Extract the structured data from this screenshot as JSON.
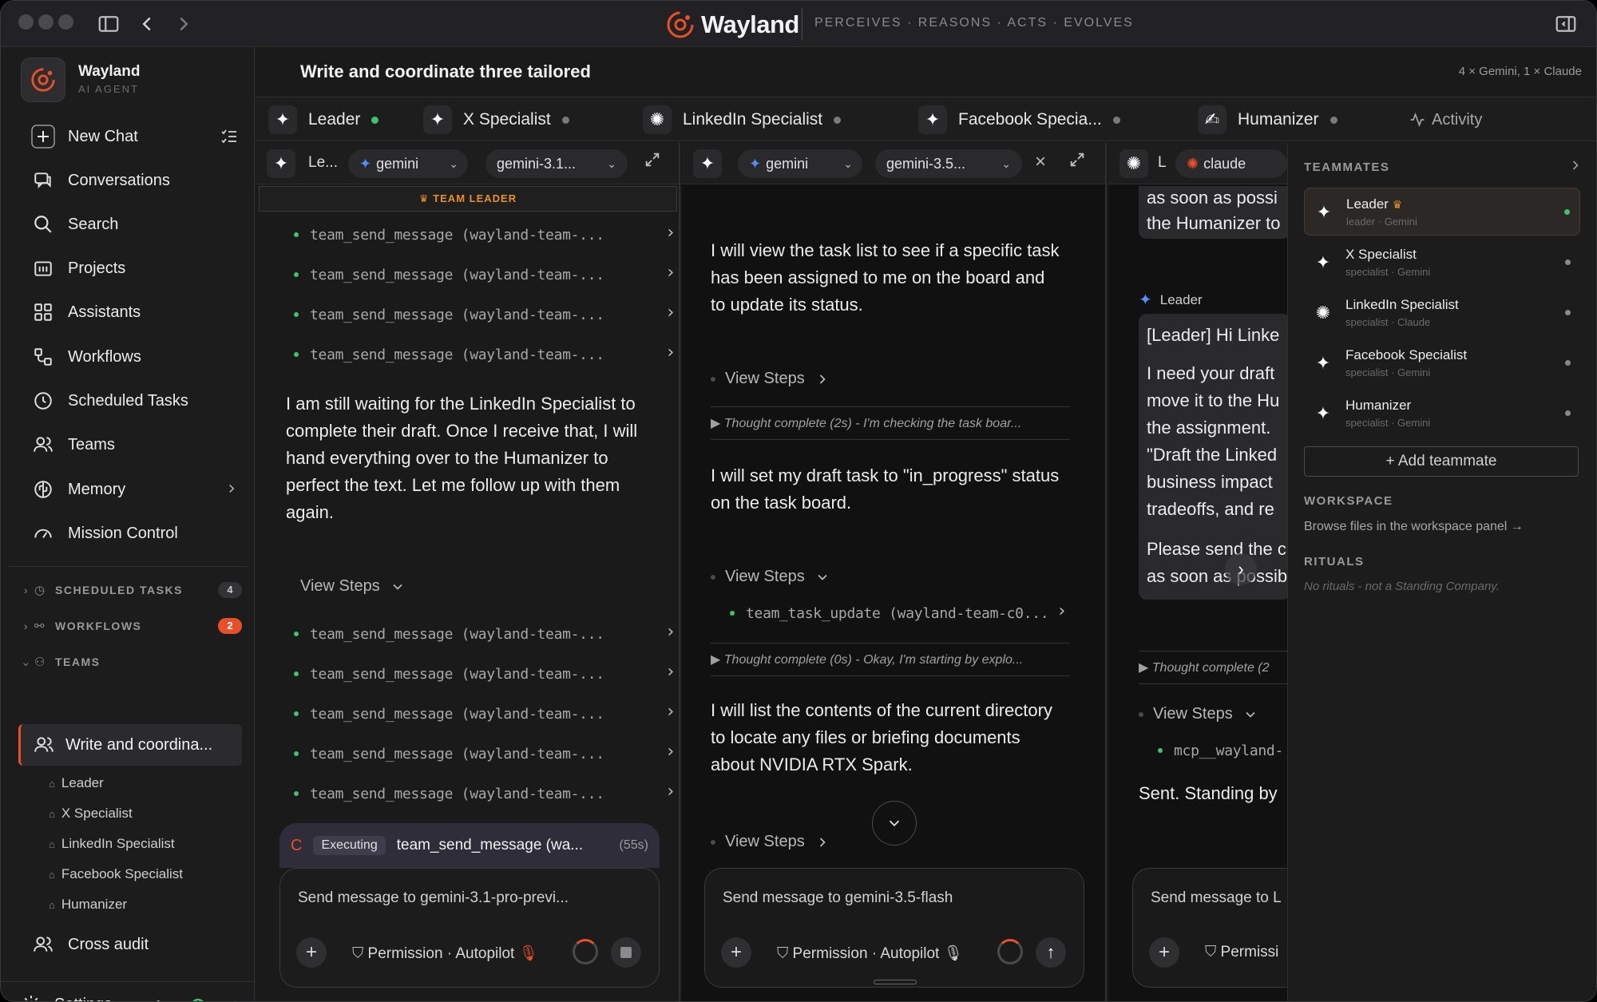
{
  "titlebar": {
    "brand": "Wayland",
    "tagline": "PERCEIVES · REASONS · ACTS · EVOLVES"
  },
  "sidebar": {
    "app_name": "Wayland",
    "app_sub": "AI AGENT",
    "nav": [
      {
        "label": "New Chat",
        "icon": "plus-icon"
      },
      {
        "label": "Conversations",
        "icon": "chat-icon"
      },
      {
        "label": "Search",
        "icon": "search-icon"
      },
      {
        "label": "Projects",
        "icon": "folder-icon"
      },
      {
        "label": "Assistants",
        "icon": "grid-icon"
      },
      {
        "label": "Workflows",
        "icon": "workflow-icon"
      },
      {
        "label": "Scheduled Tasks",
        "icon": "clock-icon"
      },
      {
        "label": "Teams",
        "icon": "users-icon"
      },
      {
        "label": "Memory",
        "icon": "brain-icon"
      },
      {
        "label": "Mission Control",
        "icon": "gauge-icon"
      }
    ],
    "sections": {
      "scheduled_tasks": {
        "label": "SCHEDULED TASKS",
        "count": "4"
      },
      "workflows": {
        "label": "WORKFLOWS",
        "count": "2"
      },
      "teams": {
        "label": "TEAMS"
      }
    },
    "active_team": "Write and coordina...",
    "team_members": [
      "Leader",
      "X Specialist",
      "LinkedIn Specialist",
      "Facebook Specialist",
      "Humanizer"
    ],
    "other_team": "Cross audit",
    "settings": "Settings"
  },
  "main": {
    "title": "Write and coordinate three tailored",
    "meta": "4 × Gemini, 1 × Claude",
    "tabs": [
      {
        "label": "Leader"
      },
      {
        "label": "X Specialist"
      },
      {
        "label": "LinkedIn Specialist"
      },
      {
        "label": "Facebook Specia..."
      },
      {
        "label": "Humanizer"
      },
      {
        "label": "Activity"
      }
    ]
  },
  "pane1": {
    "name": "Le...",
    "provider": "gemini",
    "model": "gemini-3.1...",
    "team_leader": "TEAM LEADER",
    "tool_calls_top": [
      "team_send_message (wayland-team-...",
      "team_send_message (wayland-team-...",
      "team_send_message (wayland-team-...",
      "team_send_message (wayland-team-..."
    ],
    "message": "I am still waiting for the LinkedIn Specialist to complete their draft. Once I receive that, I will hand everything over to the Humanizer to perfect the text. Let me follow up with them again.",
    "view_steps": "View Steps",
    "tool_calls_bottom": [
      "team_send_message (wayland-team-...",
      "team_send_message (wayland-team-...",
      "team_send_message (wayland-team-...",
      "team_send_message (wayland-team-...",
      "team_send_message (wayland-team-..."
    ],
    "executing_label": "Executing",
    "executing_tool": "team_send_message (wa...",
    "executing_time": "(55s)",
    "composer_placeholder": "Send message to gemini-3.1-pro-previ...",
    "permission": "Permission · Autopilot"
  },
  "pane2": {
    "provider": "gemini",
    "model": "gemini-3.5...",
    "msg1": "I will view the task list to see if a specific task has been assigned to me on the board and to update its status.",
    "view_steps": "View Steps",
    "thought1": "Thought complete (2s) - I'm checking the task boar...",
    "msg2": "I will set my draft task to \"in_progress\" status on the task board.",
    "tool": "team_task_update (wayland-team-c0...",
    "thought2": "Thought complete (0s) - Okay, I'm starting by explo...",
    "msg3": "I will list the contents of the current directory to locate any files or briefing documents about NVIDIA RTX Spark.",
    "composer_placeholder": "Send message to gemini-3.5-flash",
    "permission": "Permission · Autopilot"
  },
  "pane3": {
    "name": "L",
    "provider": "claude",
    "top_text": [
      "as soon as possi",
      "the Humanizer to"
    ],
    "sender": "Leader",
    "msg_lines": [
      "[Leader] Hi Linke",
      "I need your draft",
      "move it to the Hu",
      "the assignment.",
      "\"Draft the Linked",
      "business impact",
      "tradeoffs, and re",
      "Please send the c",
      "as soon as possib"
    ],
    "thought": "Thought complete (2",
    "view_steps": "View Steps",
    "tool": "mcp__wayland-",
    "final": "Sent. Standing by",
    "composer_placeholder": "Send message to L",
    "permission": "Permissi"
  },
  "panel": {
    "teammates_label": "TEAMMATES",
    "teammates": [
      {
        "name": "Leader",
        "role": "leader · Gemini"
      },
      {
        "name": "X Specialist",
        "role": "specialist · Gemini"
      },
      {
        "name": "LinkedIn Specialist",
        "role": "specialist · Claude"
      },
      {
        "name": "Facebook Specialist",
        "role": "specialist · Gemini"
      },
      {
        "name": "Humanizer",
        "role": "specialist · Gemini"
      }
    ],
    "add_teammate": "+ Add teammate",
    "workspace_label": "WORKSPACE",
    "workspace_link": "Browse files in the workspace panel →",
    "rituals_label": "RITUALS",
    "rituals_empty": "No rituals - not a Standing Company."
  },
  "colors": {
    "accent": "#e8502a",
    "online": "#3ec46d",
    "background": "#1e1e1f"
  }
}
